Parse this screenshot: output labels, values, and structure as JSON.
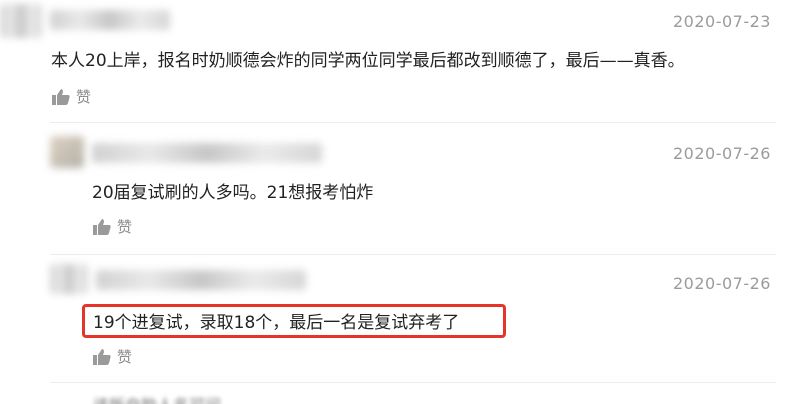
{
  "comments": [
    {
      "date": "2020-07-23",
      "text": "本人20上岸，报名时奶顺德会炸的同学两位同学最后都改到顺德了，最后——真香。",
      "like_label": "赞"
    },
    {
      "date": "2020-07-26",
      "text": "20届复试刷的人多吗。21想报考怕炸",
      "like_label": "赞"
    },
    {
      "date": "2020-07-26",
      "text": "19个进复试，录取18个，最后一名是复试弃考了",
      "like_label": "赞"
    }
  ],
  "next_comment_partial": "该版自助人名可问",
  "colors": {
    "highlight": "#e5342a",
    "date": "#9b9b9b",
    "text": "#222222"
  },
  "icons": [
    "thumbs-up-icon"
  ]
}
